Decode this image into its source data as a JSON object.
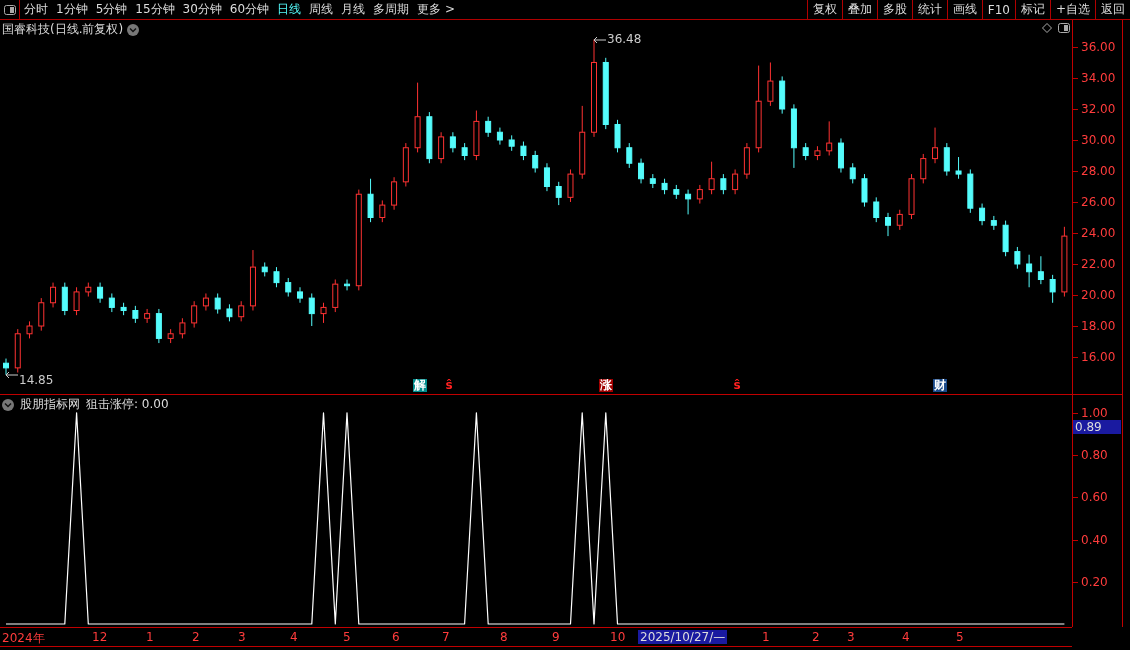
{
  "toolbar": {
    "periods": [
      {
        "label": "分时",
        "selected": false
      },
      {
        "label": "1分钟",
        "selected": false
      },
      {
        "label": "5分钟",
        "selected": false
      },
      {
        "label": "15分钟",
        "selected": false
      },
      {
        "label": "30分钟",
        "selected": false
      },
      {
        "label": "60分钟",
        "selected": false
      },
      {
        "label": "日线",
        "selected": true
      },
      {
        "label": "周线",
        "selected": false
      },
      {
        "label": "月线",
        "selected": false
      },
      {
        "label": "多周期",
        "selected": false
      },
      {
        "label": "更多 >",
        "selected": false
      }
    ],
    "actions": [
      "复权",
      "叠加",
      "多股",
      "统计",
      "画线",
      "F10",
      "标记",
      "+自选",
      "返回"
    ]
  },
  "price_panel": {
    "title": "国睿科技(日线.前复权)",
    "chart_data": {
      "type": "candlestick",
      "ylim": [
        13.55,
        37.74
      ],
      "yticks": [
        {
          "value": 16,
          "label": "16.00"
        },
        {
          "value": 18,
          "label": "18.00"
        },
        {
          "value": 20,
          "label": "20.00"
        },
        {
          "value": 22,
          "label": "22.00"
        },
        {
          "value": 24,
          "label": "24.00"
        },
        {
          "value": 26,
          "label": "26.00"
        },
        {
          "value": 28,
          "label": "28.00"
        },
        {
          "value": 30,
          "label": "30.00"
        },
        {
          "value": 32,
          "label": "32.00"
        },
        {
          "value": 34,
          "label": "34.00"
        },
        {
          "value": 36,
          "label": "36.00"
        }
      ],
      "ohlc": [
        [
          15.6,
          15.9,
          14.85,
          15.3
        ],
        [
          15.3,
          17.8,
          15,
          17.5
        ],
        [
          17.5,
          18.3,
          17.2,
          18
        ],
        [
          18,
          19.8,
          17.7,
          19.5
        ],
        [
          19.5,
          20.8,
          19.2,
          20.5
        ],
        [
          20.5,
          20.8,
          18.7,
          19
        ],
        [
          19,
          20.5,
          18.7,
          20.2
        ],
        [
          20.2,
          20.8,
          19.9,
          20.5
        ],
        [
          20.5,
          20.8,
          19.5,
          19.8
        ],
        [
          19.8,
          20.1,
          18.9,
          19.2
        ],
        [
          19.2,
          19.5,
          18.7,
          19
        ],
        [
          19,
          19.3,
          18.2,
          18.5
        ],
        [
          18.5,
          19.1,
          18.2,
          18.8
        ],
        [
          18.8,
          19.1,
          16.9,
          17.2
        ],
        [
          17.2,
          17.8,
          16.9,
          17.5
        ],
        [
          17.5,
          18.5,
          17.2,
          18.2
        ],
        [
          18.2,
          19.6,
          17.9,
          19.3
        ],
        [
          19.3,
          20.1,
          19,
          19.8
        ],
        [
          19.8,
          20.1,
          18.8,
          19.1
        ],
        [
          19.1,
          19.4,
          18.3,
          18.6
        ],
        [
          18.6,
          19.6,
          18.3,
          19.3
        ],
        [
          19.3,
          22.9,
          19,
          21.8
        ],
        [
          21.8,
          22.1,
          21.2,
          21.5
        ],
        [
          21.5,
          21.8,
          20.5,
          20.8
        ],
        [
          20.8,
          21.1,
          19.9,
          20.2
        ],
        [
          20.2,
          20.5,
          19.5,
          19.8
        ],
        [
          19.8,
          20.1,
          18,
          18.8
        ],
        [
          18.8,
          19.5,
          18.2,
          19.2
        ],
        [
          19.2,
          21,
          18.9,
          20.7
        ],
        [
          20.7,
          21,
          20.3,
          20.6
        ],
        [
          20.6,
          26.8,
          20.3,
          26.5
        ],
        [
          26.5,
          27.5,
          24.7,
          25
        ],
        [
          25,
          26.1,
          24.7,
          25.8
        ],
        [
          25.8,
          27.6,
          25.5,
          27.3
        ],
        [
          27.3,
          29.8,
          27,
          29.5
        ],
        [
          29.5,
          33.7,
          29.2,
          31.5
        ],
        [
          31.5,
          31.8,
          28.5,
          28.8
        ],
        [
          28.8,
          30.5,
          28.5,
          30.2
        ],
        [
          30.2,
          30.5,
          29.2,
          29.5
        ],
        [
          29.5,
          29.8,
          28.7,
          29
        ],
        [
          29,
          31.9,
          28.7,
          31.2
        ],
        [
          31.2,
          31.5,
          30.2,
          30.5
        ],
        [
          30.5,
          30.8,
          29.7,
          30
        ],
        [
          30,
          30.3,
          29.3,
          29.6
        ],
        [
          29.6,
          29.9,
          28.7,
          29
        ],
        [
          29,
          29.3,
          27.9,
          28.2
        ],
        [
          28.2,
          28.5,
          26.7,
          27
        ],
        [
          27,
          27.3,
          25.8,
          26.3
        ],
        [
          26.3,
          28.1,
          26,
          27.8
        ],
        [
          27.8,
          32.2,
          27.5,
          30.5
        ],
        [
          30.5,
          36.48,
          30.2,
          35
        ],
        [
          35,
          35.3,
          30.7,
          31
        ],
        [
          31,
          31.3,
          29.2,
          29.5
        ],
        [
          29.5,
          29.8,
          28.2,
          28.5
        ],
        [
          28.5,
          28.8,
          27.2,
          27.5
        ],
        [
          27.5,
          27.8,
          26.9,
          27.2
        ],
        [
          27.2,
          27.5,
          26.5,
          26.8
        ],
        [
          26.8,
          27.1,
          26.2,
          26.5
        ],
        [
          26.5,
          26.8,
          25.2,
          26.2
        ],
        [
          26.2,
          27.1,
          25.9,
          26.8
        ],
        [
          26.8,
          28.6,
          26.5,
          27.5
        ],
        [
          27.5,
          27.8,
          26.5,
          26.8
        ],
        [
          26.8,
          28.1,
          26.5,
          27.8
        ],
        [
          27.8,
          29.8,
          27.5,
          29.5
        ],
        [
          29.5,
          34.8,
          29.2,
          32.5
        ],
        [
          32.5,
          35,
          32.2,
          33.8
        ],
        [
          33.8,
          34.1,
          31.7,
          32
        ],
        [
          32,
          32.3,
          28.2,
          29.5
        ],
        [
          29.5,
          29.8,
          28.7,
          29
        ],
        [
          29,
          29.6,
          28.7,
          29.3
        ],
        [
          29.3,
          31.2,
          29,
          29.8
        ],
        [
          29.8,
          30.1,
          27.9,
          28.2
        ],
        [
          28.2,
          28.5,
          27.2,
          27.5
        ],
        [
          27.5,
          27.8,
          25.7,
          26
        ],
        [
          26,
          26.3,
          24.7,
          25
        ],
        [
          25,
          25.3,
          23.8,
          24.5
        ],
        [
          24.5,
          25.5,
          24.2,
          25.2
        ],
        [
          25.2,
          27.8,
          24.9,
          27.5
        ],
        [
          27.5,
          29.1,
          27.2,
          28.8
        ],
        [
          28.8,
          30.8,
          28.5,
          29.5
        ],
        [
          29.5,
          29.8,
          27.7,
          28
        ],
        [
          28,
          28.9,
          27.5,
          27.8
        ],
        [
          27.8,
          28.1,
          25.3,
          25.6
        ],
        [
          25.6,
          25.9,
          24.5,
          24.8
        ],
        [
          24.8,
          25.1,
          24.2,
          24.5
        ],
        [
          24.5,
          24.8,
          22.5,
          22.8
        ],
        [
          22.8,
          23.1,
          21.7,
          22
        ],
        [
          22,
          22.6,
          20.5,
          21.5
        ],
        [
          21.5,
          22.5,
          20.7,
          21
        ],
        [
          21,
          21.3,
          19.5,
          20.2
        ],
        [
          20.2,
          24.4,
          19.9,
          23.8
        ]
      ],
      "annotations": [
        "36.48",
        "14.85"
      ]
    },
    "markers": [
      {
        "kind": "badge",
        "label": "解",
        "color": "#008c8c"
      },
      {
        "kind": "glyph",
        "label": "ŝ",
        "color": "#ff2020"
      },
      {
        "kind": "badge",
        "label": "涨",
        "color": "#a00000"
      },
      {
        "kind": "glyph",
        "label": "ŝ",
        "color": "#ff2020"
      },
      {
        "kind": "badge",
        "label": "财",
        "color": "#1a4a8a"
      }
    ]
  },
  "indicator_panel": {
    "source": "股朋指标网",
    "reading": "狙击涨停: 0.00",
    "current_value": "0.89",
    "chart_data": {
      "type": "line",
      "ylim": [
        -0.014,
        1.085
      ],
      "yticks": [
        {
          "value": 0.2,
          "label": "0.20"
        },
        {
          "value": 0.4,
          "label": "0.40"
        },
        {
          "value": 0.6,
          "label": "0.60"
        },
        {
          "value": 0.8,
          "label": "0.80"
        },
        {
          "value": 1.0,
          "label": "1.00"
        }
      ],
      "series": [
        {
          "color": "#ffffff",
          "values": [
            0,
            0,
            0,
            0,
            0,
            0,
            1,
            0,
            0,
            0,
            0,
            0,
            0,
            0,
            0,
            0,
            0,
            0,
            0,
            0,
            0,
            0,
            0,
            0,
            0,
            0,
            0,
            1,
            0,
            1,
            0,
            0,
            0,
            0,
            0,
            0,
            0,
            0,
            0,
            0,
            1,
            0,
            0,
            0,
            0,
            0,
            0,
            0,
            0,
            1,
            0,
            1,
            0,
            0,
            0,
            0,
            0,
            0,
            0,
            0,
            0,
            0,
            0,
            0,
            0,
            0,
            0,
            0,
            0,
            0,
            0,
            0,
            0,
            0,
            0,
            0,
            0,
            0,
            0,
            0,
            0,
            0,
            0,
            0,
            0,
            0,
            0,
            0,
            0,
            0,
            0
          ]
        }
      ]
    }
  },
  "date_axis": [
    {
      "label": "2024年",
      "selected": false
    },
    {
      "label": "12",
      "selected": false
    },
    {
      "label": "1",
      "selected": false
    },
    {
      "label": "2",
      "selected": false
    },
    {
      "label": "3",
      "selected": false
    },
    {
      "label": "4",
      "selected": false
    },
    {
      "label": "5",
      "selected": false
    },
    {
      "label": "6",
      "selected": false
    },
    {
      "label": "7",
      "selected": false
    },
    {
      "label": "8",
      "selected": false
    },
    {
      "label": "9",
      "selected": false
    },
    {
      "label": "10",
      "selected": false
    },
    {
      "label": "2025/10/27/—",
      "selected": true
    },
    {
      "label": "1",
      "selected": false
    },
    {
      "label": "2",
      "selected": false
    },
    {
      "label": "3",
      "selected": false
    },
    {
      "label": "4",
      "selected": false
    },
    {
      "label": "5",
      "selected": false
    }
  ]
}
